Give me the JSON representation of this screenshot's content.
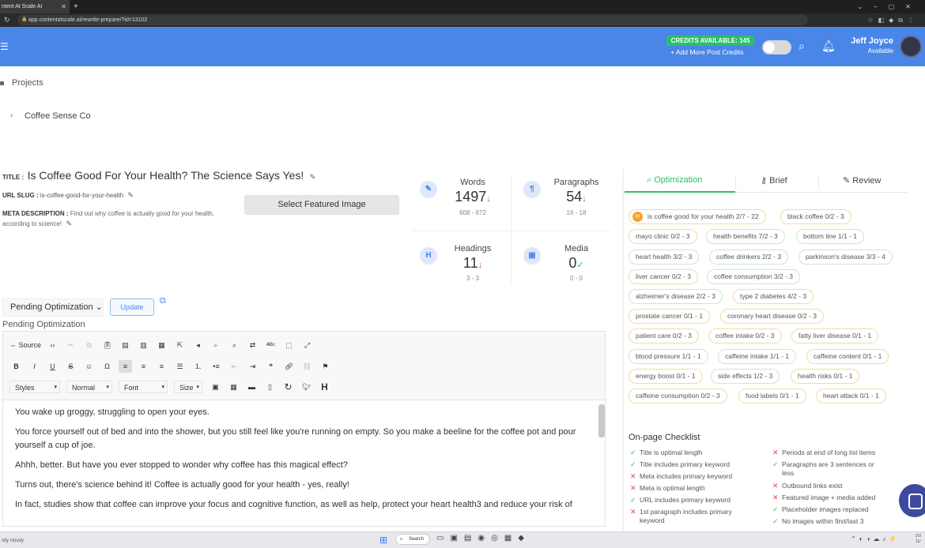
{
  "browser": {
    "tab_title": "ntent At Scale AI",
    "new_tab": "+",
    "url": "app.contentatscale.ai/rewrite-prepare/?id=13102"
  },
  "header": {
    "credits": "CREDITS AVAILABLE: 145",
    "add_credits": "+ Add More Post Credits",
    "user_name": "Jeff Joyce",
    "user_status": "Available"
  },
  "breadcrumbs": {
    "projects": "Projects",
    "project": "Coffee Sense Co"
  },
  "article": {
    "title_label": "TITLE :",
    "title": "Is Coffee Good For Your Health? The Science Says Yes!",
    "slug_label": "URL SLUG :",
    "slug": "is-coffee-good-for-your-health",
    "meta_label": "META DESCRIPTION :",
    "meta": "Find out why coffee is actually good for your health, according to science!",
    "featured_button": "Select Featured Image"
  },
  "stats": {
    "words": {
      "label": "Words",
      "value": "1497",
      "range": "608 - 672",
      "icon": "pencil-icon",
      "glyph": "✎"
    },
    "paragraphs": {
      "label": "Paragraphs",
      "value": "54",
      "range": "16 - 18",
      "icon": "paragraph-icon",
      "glyph": "¶"
    },
    "headings": {
      "label": "Headings",
      "value": "11",
      "range": "3 - 3",
      "icon": "heading-icon",
      "glyph": "H"
    },
    "media": {
      "label": "Media",
      "value": "0",
      "range": "0 - 0",
      "icon": "image-icon",
      "glyph": "▣"
    }
  },
  "editor": {
    "status_select": "Pending Optimization",
    "update_button": "Update",
    "status_label": "Pending Optimization",
    "source_button": "Source",
    "styles_dropdown": "Styles",
    "format_dropdown": "Normal",
    "font_dropdown": "Font",
    "size_dropdown": "Size",
    "paragraphs": [
      "You wake up groggy, struggling to open your eyes.",
      "You force yourself out of bed and into the shower, but you still feel like you're running on empty. So you make a beeline for the coffee pot and pour yourself a cup of joe.",
      "Ahhh, better. But have you ever stopped to wonder why coffee has this magical effect?",
      "Turns out, there's science behind it! Coffee is actually good for your health - yes, really!",
      "In fact, studies show that coffee can improve your focus and cognitive function, as well as help, protect your heart health3 and reduce your risk of"
    ]
  },
  "panel": {
    "tabs": [
      "Optimization",
      "Brief",
      "Review"
    ],
    "keywords": [
      "is coffee good for your health 2/7 - 22",
      "black coffee 0/2 - 3",
      "mayo clinic 0/2 - 3",
      "health benefits 7/2 - 3",
      "bottom line 1/1 - 1",
      "heart health 3/2 - 3",
      "coffee drinkers 2/2 - 3",
      "parkinson's disease 3/3 - 4",
      "liver cancer 0/2 - 3",
      "coffee consumption 3/2 - 3",
      "alzheimer's disease 2/2 - 3",
      "type 2 diabetes 4/2 - 3",
      "prostate cancer 0/1 - 1",
      "coronary heart disease 0/2 - 3",
      "patient care 0/2 - 3",
      "coffee intake 0/2 - 3",
      "fatty liver disease 0/1 - 1",
      "blood pressure 1/1 - 1",
      "caffeine intake 1/1 - 1",
      "caffeine content 0/1 - 1",
      "energy boost 0/1 - 1",
      "side effects 1/2 - 3",
      "health risks 0/1 - 1",
      "caffeine consumption 0/2 - 3",
      "food labels 0/1 - 1",
      "heart attack 0/1 - 1"
    ],
    "checklist_title": "On-page Checklist",
    "checklist_left": [
      {
        "text": "Title is optimal length",
        "ok": true
      },
      {
        "text": "Title includes primary keyword",
        "ok": true
      },
      {
        "text": "Meta includes primary keyword",
        "ok": false
      },
      {
        "text": "Meta is optimal length",
        "ok": false
      },
      {
        "text": "URL includes primary keyword",
        "ok": true
      },
      {
        "text": "1st paragraph includes primary keyword",
        "ok": false
      }
    ],
    "checklist_right": [
      {
        "text": "Periods at end of long list items",
        "ok": false
      },
      {
        "text": "Paragraphs are 3 sentences or less",
        "ok": true
      },
      {
        "text": "Outbound links exist",
        "ok": false
      },
      {
        "text": "Featured image + media added",
        "ok": false
      },
      {
        "text": "Placeholder images replaced",
        "ok": true
      },
      {
        "text": "No images within first/last 3",
        "ok": true
      }
    ]
  },
  "taskbar": {
    "weather": "stly cloudy",
    "search": "Search"
  }
}
